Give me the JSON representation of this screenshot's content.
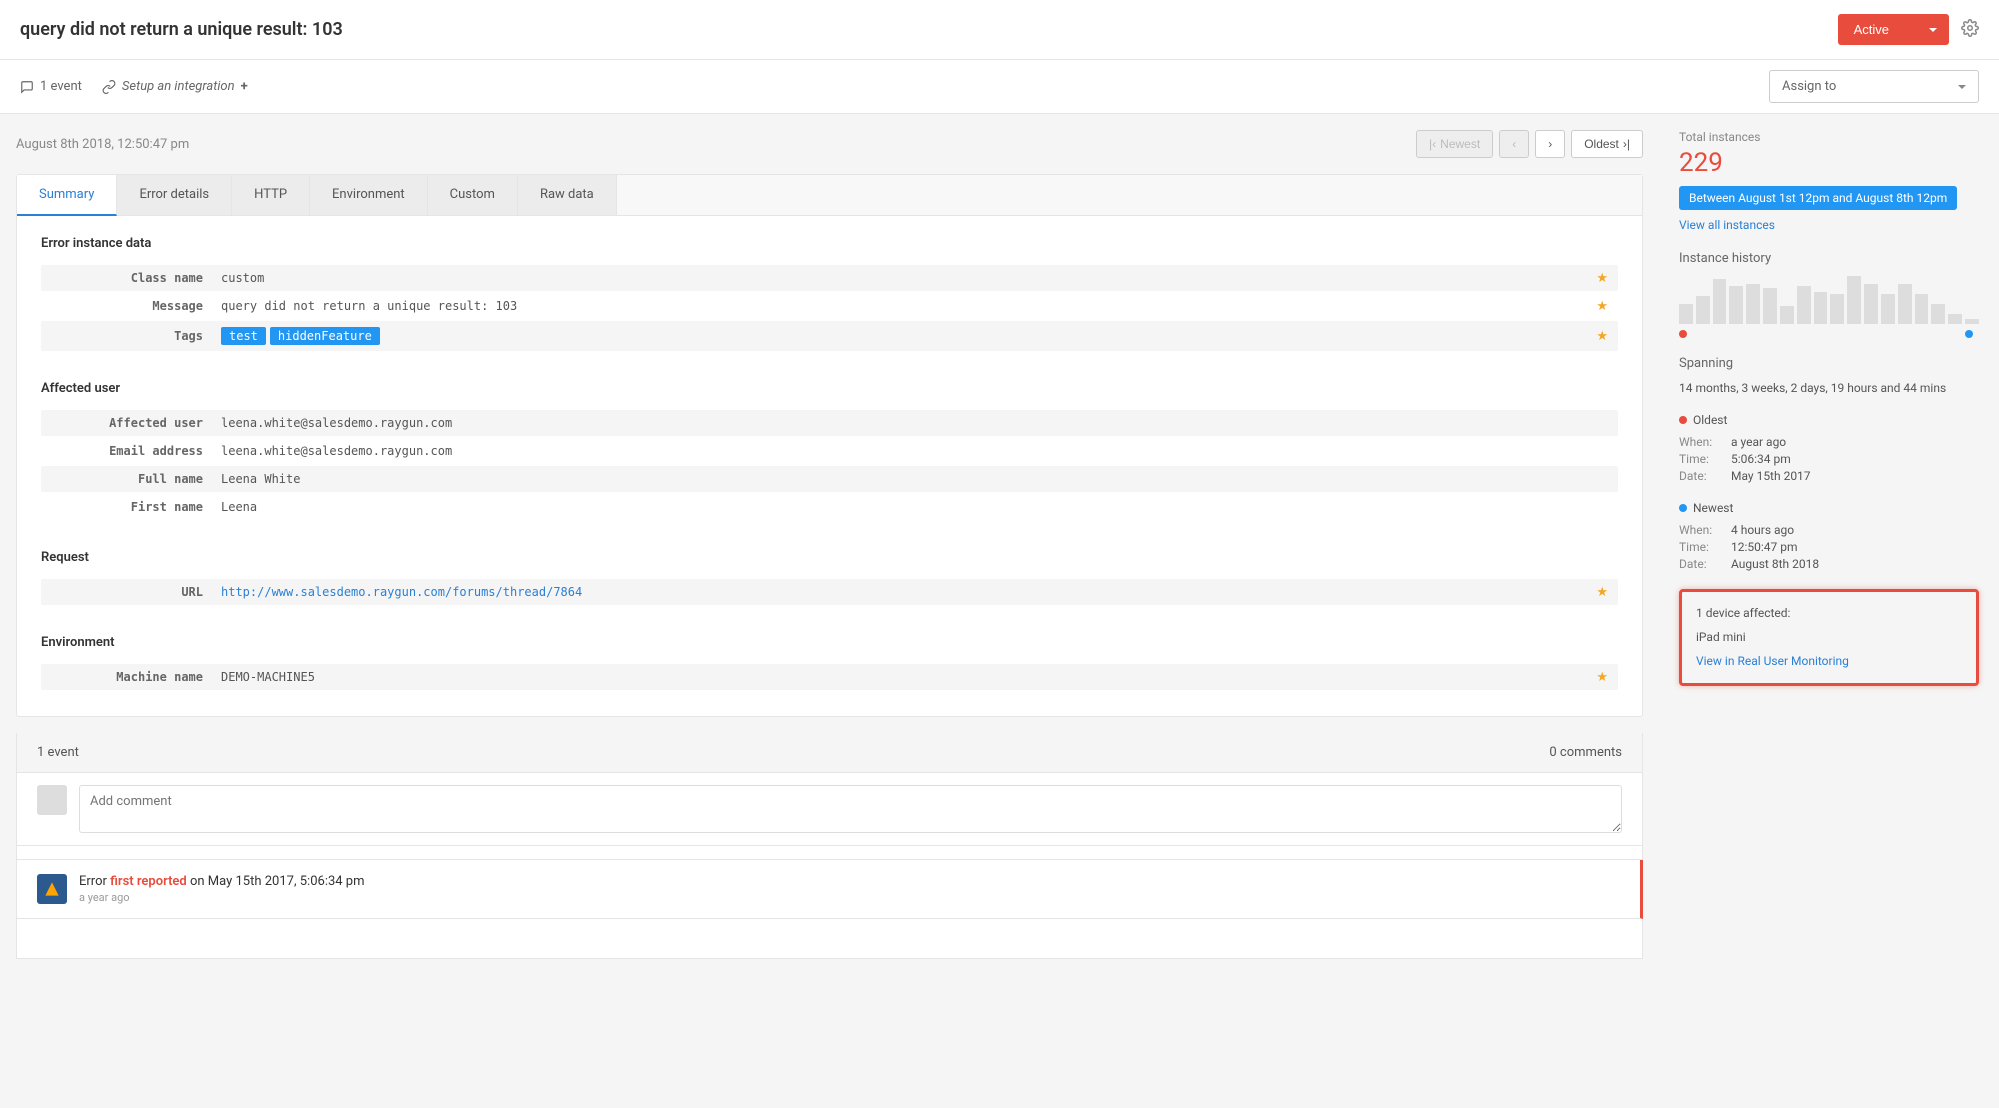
{
  "header": {
    "title": "query did not return a unique result: 103",
    "active_label": "Active",
    "assign_label": "Assign to"
  },
  "subbar": {
    "event_count": "1 event",
    "integration": "Setup an integration"
  },
  "timestamp": "August 8th 2018, 12:50:47 pm",
  "pager": {
    "newest": "Newest",
    "oldest": "Oldest"
  },
  "tabs": [
    "Summary",
    "Error details",
    "HTTP",
    "Environment",
    "Custom",
    "Raw data"
  ],
  "sections": {
    "error": {
      "title": "Error instance data",
      "class_name_label": "Class name",
      "class_name": "custom",
      "message_label": "Message",
      "message": "query did not return a unique result: 103",
      "tags_label": "Tags",
      "tags": [
        "test",
        "hiddenFeature"
      ]
    },
    "user": {
      "title": "Affected user",
      "affected_label": "Affected user",
      "affected": "leena.white@salesdemo.raygun.com",
      "email_label": "Email address",
      "email": "leena.white@salesdemo.raygun.com",
      "fullname_label": "Full name",
      "fullname": "Leena White",
      "firstname_label": "First name",
      "firstname": "Leena"
    },
    "request": {
      "title": "Request",
      "url_label": "URL",
      "url": "http://www.salesdemo.raygun.com/forums/thread/7864"
    },
    "env": {
      "title": "Environment",
      "machine_label": "Machine name",
      "machine": "DEMO-MACHINE5"
    }
  },
  "events": {
    "count": "1 event",
    "comments": "0 comments",
    "placeholder": "Add comment",
    "first_reported_prefix": "Error ",
    "first_reported_red": "first reported",
    "first_reported_suffix": " on May 15th 2017, 5:06:34 pm",
    "when": "a year ago"
  },
  "sidebar": {
    "total_label": "Total instances",
    "total": "229",
    "range": "Between August 1st 12pm and August 8th 12pm",
    "view_all": "View all instances",
    "history_label": "Instance history",
    "spanning_label": "Spanning",
    "spanning": "14 months, 3 weeks, 2 days, 19 hours and 44 mins",
    "oldest_label": "Oldest",
    "oldest_when": "a year ago",
    "oldest_time": "5:06:34 pm",
    "oldest_date": "May 15th 2017",
    "newest_label": "Newest",
    "newest_when": "4 hours ago",
    "newest_time": "12:50:47 pm",
    "newest_date": "August 8th 2018",
    "devices_label": "1 device affected:",
    "device": "iPad mini",
    "rum_link": "View in Real User Monitoring",
    "when_lbl": "When:",
    "time_lbl": "Time:",
    "date_lbl": "Date:"
  },
  "chart_data": {
    "type": "bar",
    "values": [
      20,
      28,
      45,
      38,
      40,
      36,
      18,
      38,
      32,
      30,
      48,
      40,
      30,
      40,
      30,
      20,
      10,
      5
    ]
  }
}
